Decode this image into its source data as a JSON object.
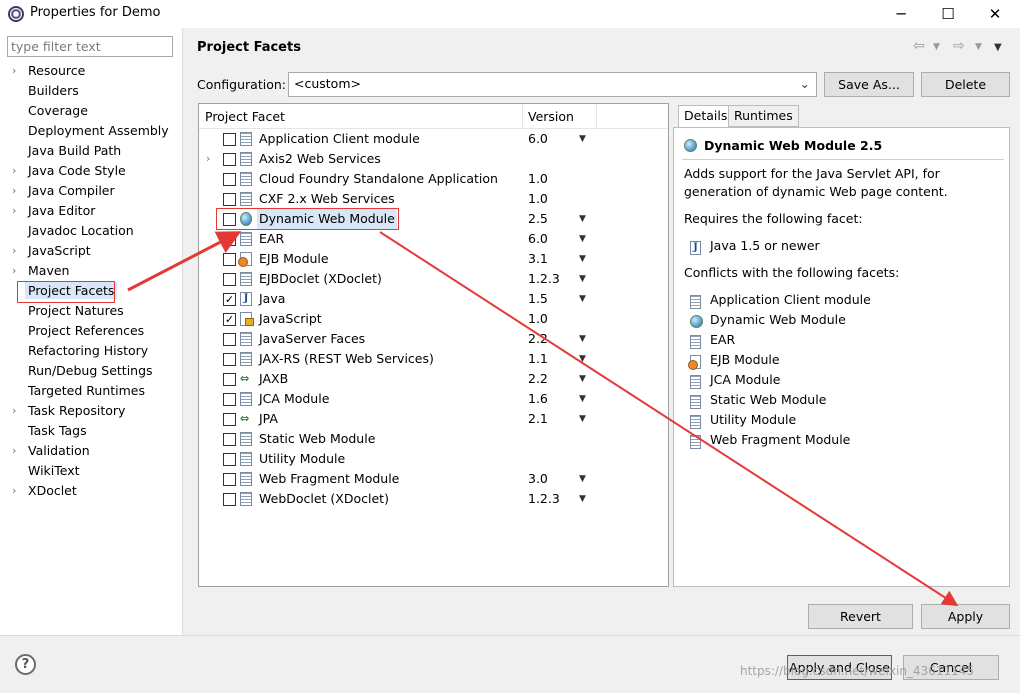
{
  "window": {
    "title": "Properties for Demo",
    "minimize": "─",
    "maximize": "☐",
    "close": "✕"
  },
  "filter": {
    "placeholder": "type filter text",
    "value": ""
  },
  "nav": {
    "items": [
      {
        "label": "Resource",
        "expandable": true
      },
      {
        "label": "Builders",
        "expandable": false
      },
      {
        "label": "Coverage",
        "expandable": false
      },
      {
        "label": "Deployment Assembly",
        "expandable": false
      },
      {
        "label": "Java Build Path",
        "expandable": false
      },
      {
        "label": "Java Code Style",
        "expandable": true
      },
      {
        "label": "Java Compiler",
        "expandable": true
      },
      {
        "label": "Java Editor",
        "expandable": true
      },
      {
        "label": "Javadoc Location",
        "expandable": false
      },
      {
        "label": "JavaScript",
        "expandable": true
      },
      {
        "label": "Maven",
        "expandable": true
      },
      {
        "label": "Project Facets",
        "expandable": false,
        "selected": true
      },
      {
        "label": "Project Natures",
        "expandable": false
      },
      {
        "label": "Project References",
        "expandable": false
      },
      {
        "label": "Refactoring History",
        "expandable": false
      },
      {
        "label": "Run/Debug Settings",
        "expandable": false
      },
      {
        "label": "Targeted Runtimes",
        "expandable": false
      },
      {
        "label": "Task Repository",
        "expandable": true
      },
      {
        "label": "Task Tags",
        "expandable": false
      },
      {
        "label": "Validation",
        "expandable": true
      },
      {
        "label": "WikiText",
        "expandable": false
      },
      {
        "label": "XDoclet",
        "expandable": true
      }
    ]
  },
  "header": {
    "title": "Project Facets",
    "back_icon": "back-arrow-icon",
    "forward_icon": "forward-arrow-icon",
    "menu_icon": "view-menu-icon"
  },
  "configuration": {
    "label": "Configuration:",
    "value": "<custom>",
    "save_as_label": "Save As...",
    "delete_label": "Delete"
  },
  "facets": {
    "col_facet": "Project Facet",
    "col_version": "Version",
    "rows": [
      {
        "name": "Application Client module",
        "version": "6.0",
        "checked": false,
        "dropdown": true,
        "icon": "doc",
        "expandable": false
      },
      {
        "name": "Axis2 Web Services",
        "version": "",
        "checked": false,
        "dropdown": false,
        "icon": "doc",
        "expandable": true
      },
      {
        "name": "Cloud Foundry Standalone Application",
        "version": "1.0",
        "checked": false,
        "dropdown": false,
        "icon": "doc",
        "expandable": false
      },
      {
        "name": "CXF 2.x Web Services",
        "version": "1.0",
        "checked": false,
        "dropdown": false,
        "icon": "doc",
        "expandable": false
      },
      {
        "name": "Dynamic Web Module",
        "version": "2.5",
        "checked": false,
        "dropdown": true,
        "icon": "globe",
        "expandable": false,
        "highlighted": true
      },
      {
        "name": "EAR",
        "version": "6.0",
        "checked": false,
        "dropdown": true,
        "icon": "doc",
        "expandable": false
      },
      {
        "name": "EJB Module",
        "version": "3.1",
        "checked": false,
        "dropdown": true,
        "icon": "ejb",
        "expandable": false
      },
      {
        "name": "EJBDoclet (XDoclet)",
        "version": "1.2.3",
        "checked": false,
        "dropdown": true,
        "icon": "doc",
        "expandable": false
      },
      {
        "name": "Java",
        "version": "1.5",
        "checked": true,
        "dropdown": true,
        "icon": "java",
        "expandable": false
      },
      {
        "name": "JavaScript",
        "version": "1.0",
        "checked": true,
        "dropdown": false,
        "icon": "js",
        "expandable": false
      },
      {
        "name": "JavaServer Faces",
        "version": "2.2",
        "checked": false,
        "dropdown": true,
        "icon": "doc",
        "expandable": false
      },
      {
        "name": "JAX-RS (REST Web Services)",
        "version": "1.1",
        "checked": false,
        "dropdown": true,
        "icon": "doc",
        "expandable": false
      },
      {
        "name": "JAXB",
        "version": "2.2",
        "checked": false,
        "dropdown": true,
        "icon": "jaxb",
        "expandable": false
      },
      {
        "name": "JCA Module",
        "version": "1.6",
        "checked": false,
        "dropdown": true,
        "icon": "doc",
        "expandable": false
      },
      {
        "name": "JPA",
        "version": "2.1",
        "checked": false,
        "dropdown": true,
        "icon": "jaxb",
        "expandable": false
      },
      {
        "name": "Static Web Module",
        "version": "",
        "checked": false,
        "dropdown": false,
        "icon": "doc",
        "expandable": false
      },
      {
        "name": "Utility Module",
        "version": "",
        "checked": false,
        "dropdown": false,
        "icon": "doc",
        "expandable": false
      },
      {
        "name": "Web Fragment Module",
        "version": "3.0",
        "checked": false,
        "dropdown": true,
        "icon": "doc",
        "expandable": false
      },
      {
        "name": "WebDoclet (XDoclet)",
        "version": "1.2.3",
        "checked": false,
        "dropdown": true,
        "icon": "doc",
        "expandable": false
      }
    ]
  },
  "details": {
    "tab_details": "Details",
    "tab_runtimes": "Runtimes",
    "title": "Dynamic Web Module 2.5",
    "desc_line1": "Adds support for the Java Servlet API, for",
    "desc_line2": "generation of dynamic Web page content.",
    "requires_label": "Requires the following facet:",
    "requires": [
      {
        "name": "Java 1.5 or newer",
        "icon": "java"
      }
    ],
    "conflicts_label": "Conflicts with the following facets:",
    "conflicts": [
      {
        "name": "Application Client module",
        "icon": "doc"
      },
      {
        "name": "Dynamic Web Module",
        "icon": "globe"
      },
      {
        "name": "EAR",
        "icon": "doc"
      },
      {
        "name": "EJB Module",
        "icon": "ejb"
      },
      {
        "name": "JCA Module",
        "icon": "doc"
      },
      {
        "name": "Static Web Module",
        "icon": "doc"
      },
      {
        "name": "Utility Module",
        "icon": "doc"
      },
      {
        "name": "Web Fragment Module",
        "icon": "doc"
      }
    ]
  },
  "buttons": {
    "revert": "Revert",
    "apply": "Apply",
    "apply_close": "Apply and Close",
    "cancel": "Cancel",
    "help": "?"
  },
  "watermark": "https://blog.csdn.net/weixin_43611145",
  "colors": {
    "annotation": "#e53935",
    "selection": "#d8e6f5",
    "default_button_border": "#0078d7"
  }
}
